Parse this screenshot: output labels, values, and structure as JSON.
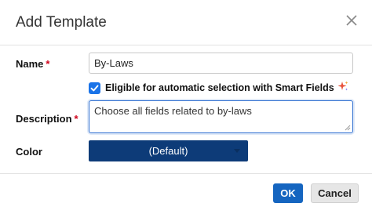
{
  "dialog": {
    "title": "Add Template"
  },
  "form": {
    "name_label": "Name",
    "required_marker": "*",
    "name_value": "By-Laws",
    "smart_fields_checkbox": {
      "checked": true,
      "label": "Eligible for automatic selection with Smart Fields"
    },
    "description_label": "Description",
    "description_value": "Choose all fields related to by-laws",
    "color_label": "Color",
    "color_value": "(Default)"
  },
  "footer": {
    "ok_label": "OK",
    "cancel_label": "Cancel"
  },
  "colors": {
    "primary": "#1565c0",
    "color_swatch": "#0d3b78",
    "required": "#d0021b",
    "checkbox": "#1a73e8"
  },
  "icons": {
    "close": "close-icon",
    "check": "checkmark-icon",
    "sparkle": "sparkle-icon",
    "caret": "chevron-down-icon"
  }
}
